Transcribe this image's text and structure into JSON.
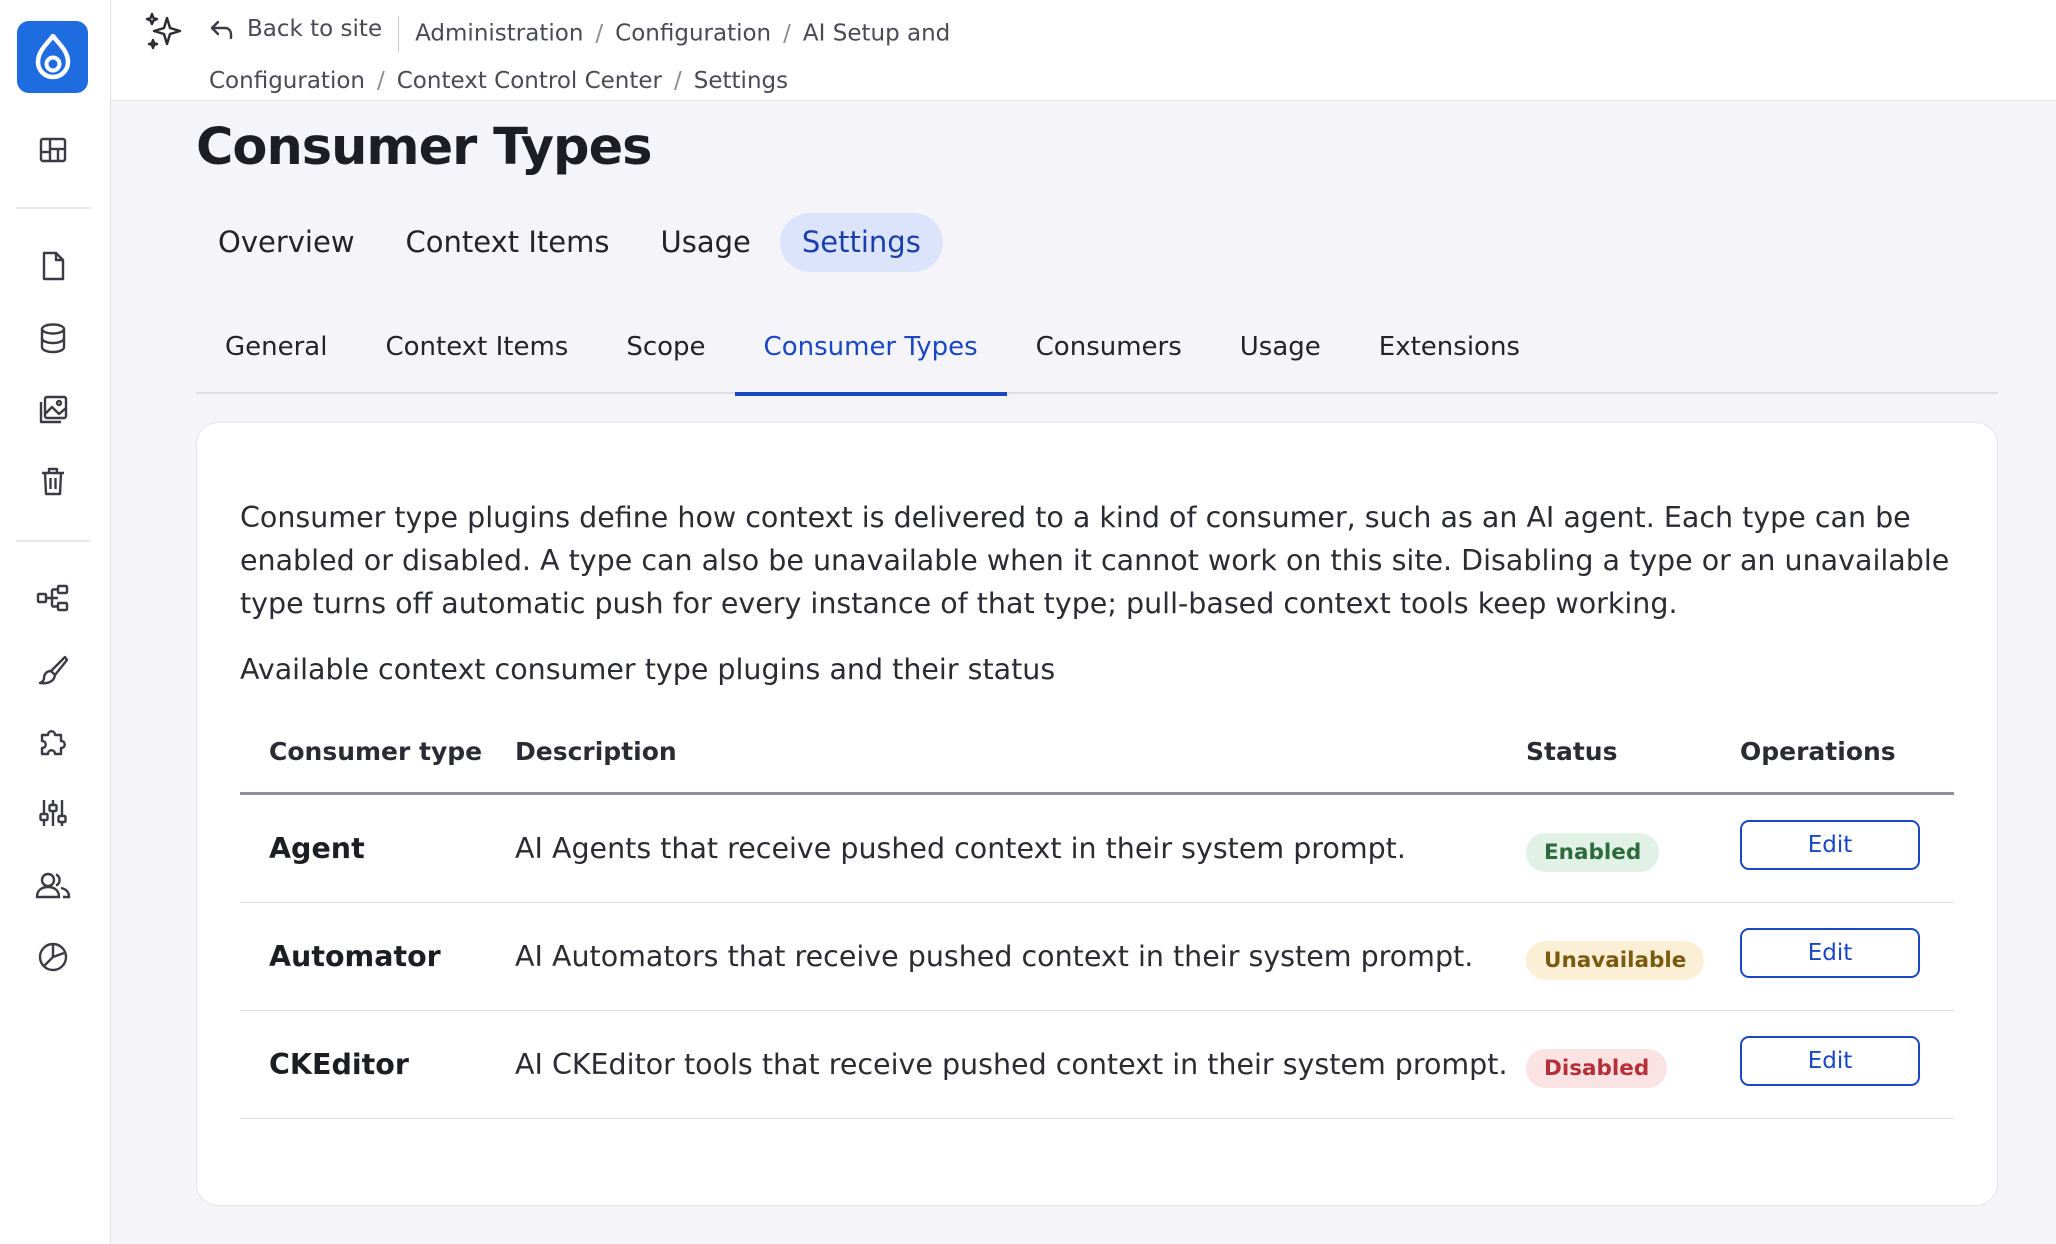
{
  "sidebar": {
    "logo": "drupal-logo",
    "icons": [
      "dashboard-icon",
      "content-icon",
      "database-icon",
      "media-icon",
      "trash-icon",
      "structure-icon",
      "appearance-brush-icon",
      "extend-puzzle-icon",
      "configuration-sliders-icon",
      "people-icon",
      "reports-chart-icon"
    ]
  },
  "topbar": {
    "back_label": "Back to site",
    "breadcrumb": [
      "Administration",
      "Configuration",
      "AI Setup and Configuration",
      "Context Control Center",
      "Settings"
    ]
  },
  "page_title": "Consumer Types",
  "primary_tabs": [
    {
      "label": "Overview",
      "active": false
    },
    {
      "label": "Context Items",
      "active": false
    },
    {
      "label": "Usage",
      "active": false
    },
    {
      "label": "Settings",
      "active": true
    }
  ],
  "secondary_tabs": [
    {
      "label": "General",
      "active": false
    },
    {
      "label": "Context Items",
      "active": false
    },
    {
      "label": "Scope",
      "active": false
    },
    {
      "label": "Consumer Types",
      "active": true
    },
    {
      "label": "Consumers",
      "active": false
    },
    {
      "label": "Usage",
      "active": false
    },
    {
      "label": "Extensions",
      "active": false
    }
  ],
  "description": "Consumer type plugins define how context is delivered to a kind of consumer, such as an AI agent. Each type can be enabled or disabled. A type can also be unavailable when it cannot work on this site. Disabling a type or an unavailable type turns off automatic push for every instance of that type; pull-based context tools keep working.",
  "table": {
    "caption": "Available context consumer type plugins and their status",
    "headers": {
      "type": "Consumer type",
      "description": "Description",
      "status": "Status",
      "operations": "Operations"
    },
    "rows": [
      {
        "type": "Agent",
        "description": "AI Agents that receive pushed context in their system prompt.",
        "status": "Enabled",
        "operation": "Edit"
      },
      {
        "type": "Automator",
        "description": "AI Automators that receive pushed context in their system prompt.",
        "status": "Unavailable",
        "operation": "Edit"
      },
      {
        "type": "CKEditor",
        "description": "AI CKEditor tools that receive pushed context in their system prompt.",
        "status": "Disabled",
        "operation": "Edit"
      }
    ]
  },
  "colors": {
    "accent": "#1a48c4",
    "logo_bg": "#1f6be0",
    "enabled": "#2d6b3c",
    "unavailable": "#7a5a10",
    "disabled": "#b53038"
  }
}
